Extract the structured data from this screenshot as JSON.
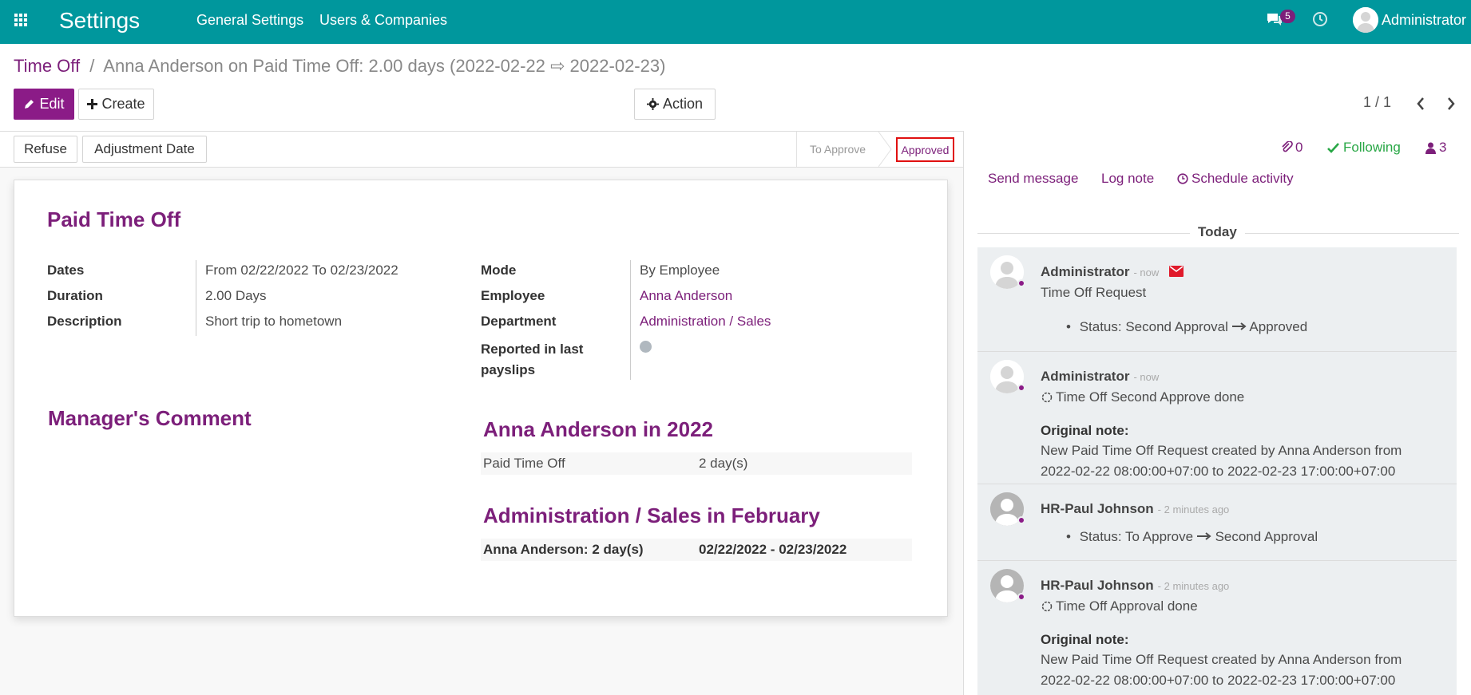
{
  "topbar": {
    "app_title": "Settings",
    "menu": [
      "General Settings",
      "Users & Companies"
    ],
    "messages_count": "5",
    "user": "Administrator",
    "color": "#00979d"
  },
  "breadcrumb": {
    "root": "Time Off",
    "separator": "/",
    "current": "Anna Anderson on Paid Time Off: 2.00 days (2022-02-22 ⇨ 2022-02-23)"
  },
  "buttons": {
    "edit": "Edit",
    "create": "Create",
    "action": "Action",
    "refuse": "Refuse",
    "adjustment_date": "Adjustment Date"
  },
  "pager": "1 / 1",
  "status": {
    "states": [
      "To Approve",
      "Approved"
    ],
    "current": "Approved"
  },
  "form": {
    "title": "Paid Time Off",
    "dates_label": "Dates",
    "from_word": "From",
    "date_from": "02/22/2022",
    "to_word": "To",
    "date_to": "02/23/2022",
    "duration_label": "Duration",
    "duration_value": "2.00",
    "duration_unit": "Days",
    "description_label": "Description",
    "description_value": "Short trip to hometown",
    "mode_label": "Mode",
    "mode_value": "By Employee",
    "employee_label": "Employee",
    "employee_value": "Anna Anderson",
    "department_label": "Department",
    "department_value": "Administration / Sales",
    "reported_label_1": "Reported in last",
    "reported_label_2": "payslips",
    "manager_comment_title": "Manager's Comment",
    "summary_title": "Anna Anderson in 2022",
    "summary_row_label": "Paid Time Off",
    "summary_row_value": "2 day(s)",
    "dept_title": "Administration / Sales in February",
    "dept_row_label": "Anna Anderson: 2 day(s)",
    "dept_row_value": "02/22/2022 - 02/23/2022"
  },
  "chatter": {
    "attachments": "0",
    "following": "Following",
    "followers": "3",
    "send_message": "Send message",
    "log_note": "Log note",
    "schedule_activity": "Schedule activity",
    "date_separator": "Today",
    "messages": [
      {
        "author": "Administrator",
        "ago": "- now",
        "subject": "Time Off Request",
        "tracking_label": "Status:",
        "from": "Second Approval",
        "to": "Approved"
      },
      {
        "author": "Administrator",
        "ago": "- now",
        "activity": "Time Off Second Approve done",
        "note_label": "Original note:",
        "note_line1": "New Paid Time Off Request created by Anna Anderson from",
        "note_line2": "2022-02-22 08:00:00+07:00 to 2022-02-23 17:00:00+07:00"
      },
      {
        "author": "HR-Paul Johnson",
        "ago": "- 2 minutes ago",
        "tracking_label": "Status:",
        "from": "To Approve",
        "to": "Second Approval"
      },
      {
        "author": "HR-Paul Johnson",
        "ago": "- 2 minutes ago",
        "activity": "Time Off Approval done",
        "note_label": "Original note:",
        "note_line1": "New Paid Time Off Request created by Anna Anderson from",
        "note_line2": "2022-02-22 08:00:00+07:00 to 2022-02-23 17:00:00+07:00"
      }
    ]
  }
}
